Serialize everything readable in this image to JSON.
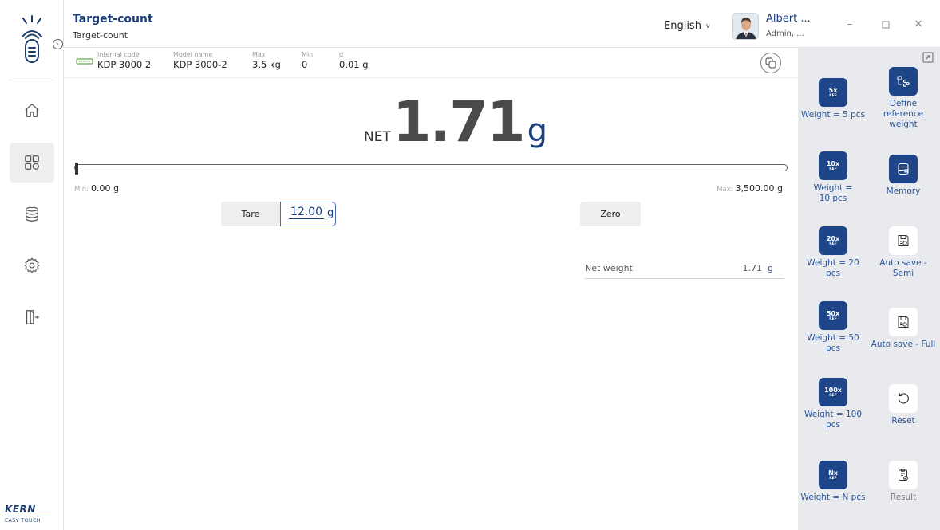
{
  "header": {
    "title": "Target-count",
    "subtitle": "Target-count",
    "language": "English",
    "user_name": "Albert ...",
    "user_role": "Admin, ..."
  },
  "sidebar": {
    "brand": "KERN",
    "brand_sub": "EASY TOUCH",
    "items": [
      {
        "icon": "home-icon"
      },
      {
        "icon": "grid-icon",
        "active": true
      },
      {
        "icon": "database-icon"
      },
      {
        "icon": "settings-icon"
      },
      {
        "icon": "logout-icon"
      }
    ]
  },
  "device": {
    "internal_code_label": "Internal code",
    "internal_code": "KDP 3000 2",
    "model_name_label": "Model name",
    "model_name": "KDP 3000-2",
    "max_label": "Max",
    "max": "3.5 kg",
    "min_label": "Min",
    "min": "0",
    "d_label": "d",
    "d": "0.01 g"
  },
  "display": {
    "net_label": "NET",
    "value": "1.71",
    "unit": "g",
    "range_fraction": 0.0005
  },
  "range": {
    "min_prefix": "Min:",
    "min_value": "0.00 g",
    "max_prefix": "Max:",
    "max_value": "3,500.00 g"
  },
  "controls": {
    "tare_label": "Tare",
    "tare_value": "12.00",
    "tare_unit": "g",
    "zero_label": "Zero"
  },
  "net_weight": {
    "label": "Net weight",
    "value": "1.71",
    "unit": "g"
  },
  "right_panel": {
    "weight_5": {
      "big": "5x",
      "small": "REF",
      "label": "Weight = 5 pcs"
    },
    "weight_10": {
      "big": "10x",
      "small": "REF",
      "label": "Weight = 10 pcs"
    },
    "weight_20": {
      "big": "20x",
      "small": "REF",
      "label": "Weight = 20 pcs"
    },
    "weight_50": {
      "big": "50x",
      "small": "REF",
      "label": "Weight = 50 pcs"
    },
    "weight_100": {
      "big": "100x",
      "small": "REF",
      "label": "Weight = 100 pcs"
    },
    "weight_n": {
      "big": "Nx",
      "small": "REF",
      "label": "Weight = N pcs"
    },
    "define_ref": {
      "label": "Define reference weight"
    },
    "memory": {
      "label": "Memory"
    },
    "auto_semi": {
      "label": "Auto save - Semi"
    },
    "auto_full": {
      "label": "Auto save - Full"
    },
    "reset": {
      "label": "Reset"
    },
    "result": {
      "label": "Result"
    }
  },
  "colors": {
    "accent": "#1c3f80",
    "button_blue": "#1d4587",
    "panel_bg": "#e9eaee"
  }
}
